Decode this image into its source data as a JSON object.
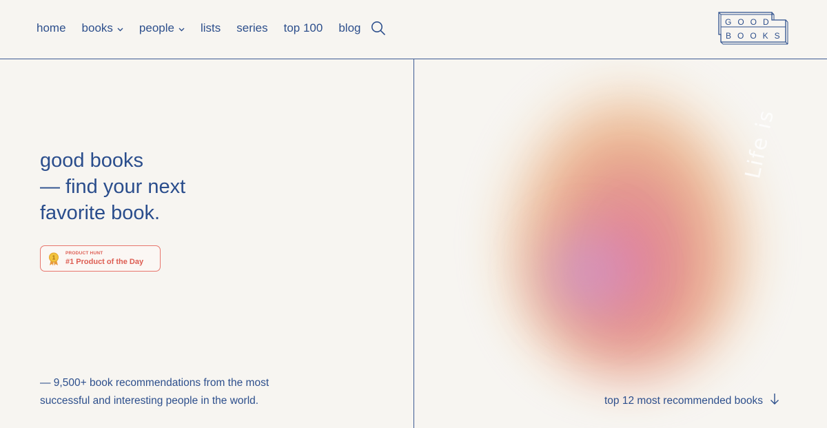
{
  "nav": {
    "items": [
      {
        "label": "home",
        "has_dropdown": false
      },
      {
        "label": "books",
        "has_dropdown": true
      },
      {
        "label": "people",
        "has_dropdown": true
      },
      {
        "label": "lists",
        "has_dropdown": false
      },
      {
        "label": "series",
        "has_dropdown": false
      },
      {
        "label": "top 100",
        "has_dropdown": false
      },
      {
        "label": "blog",
        "has_dropdown": false
      }
    ],
    "search_icon": "search-icon"
  },
  "logo": {
    "line1": "GOOD",
    "line2": "BOOKS"
  },
  "hero": {
    "title_line1": "good books",
    "title_line2": "— find your next",
    "title_line3": "favorite book.",
    "subtitle": "— 9,500+ book recommendations from the most successful and interesting people in the world."
  },
  "badge": {
    "kicker": "PRODUCT HUNT",
    "label": "#1 Product of the Day",
    "icon": "medal-icon"
  },
  "right": {
    "swirl_text": "Life is",
    "top_link": "top 12 most recommended books",
    "arrow_icon": "arrow-down-icon"
  },
  "colors": {
    "background": "#f7f5f1",
    "primary": "#2d4f8c",
    "badge_accent": "#dd5d52",
    "divider": "#3d5a93"
  }
}
